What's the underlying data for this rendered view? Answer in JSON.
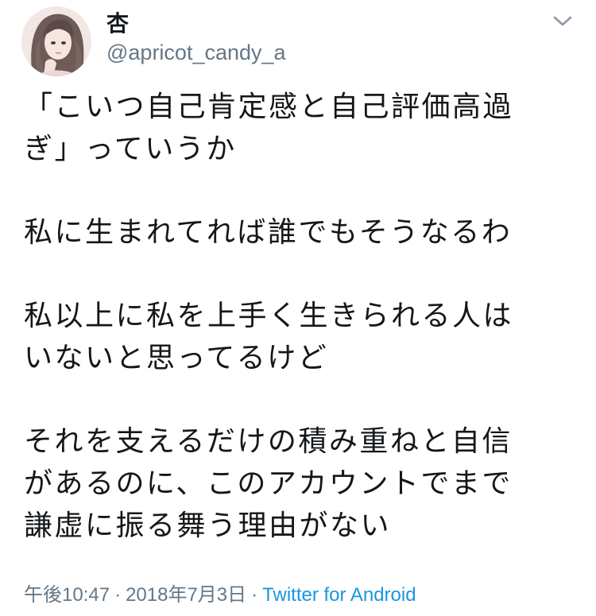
{
  "author": {
    "display_name": "杏",
    "handle": "@apricot_candy_a"
  },
  "tweet": {
    "paragraphs": [
      [
        "「こいつ自己肯定感と自己評価高過",
        "ぎ」っていうか"
      ],
      [
        "私に生まれてれば誰でもそうなるわ"
      ],
      [
        "私以上に私を上手く生きられる人は",
        "いないと思ってるけど"
      ],
      [
        "それを支えるだけの積み重ねと自信",
        "があるのに、このアカウントでまで",
        "謙虚に振る舞う理由がない"
      ]
    ]
  },
  "meta": {
    "time": "午後10:47",
    "separator": "·",
    "date": "2018年7月3日",
    "source": "Twitter for Android"
  },
  "icons": {
    "avatar": "user-avatar",
    "menu": "chevron-down-icon"
  },
  "colors": {
    "text": "#14171a",
    "secondary": "#657786",
    "link": "#1b95e0"
  }
}
